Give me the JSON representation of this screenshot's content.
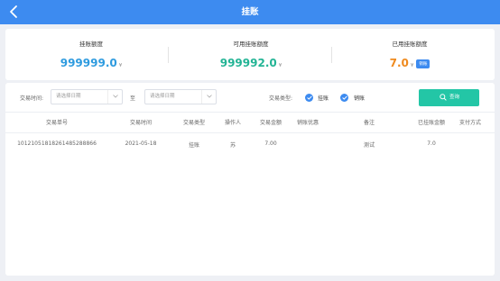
{
  "header": {
    "title": "挂账",
    "back_icon": "chevron-left-icon",
    "color": "#3d8bf0"
  },
  "summary": {
    "credit_limit": {
      "label": "挂账额度",
      "value": "999999.0",
      "unit": "¥",
      "color": "#2e9bdf"
    },
    "available_limit": {
      "label": "可用挂账额度",
      "value": "999992.0",
      "unit": "¥",
      "color": "#23b495"
    },
    "used_limit": {
      "label": "已用挂账额度",
      "value": "7.0",
      "unit": "¥",
      "color": "#ef8a1e",
      "action_label": "销账"
    }
  },
  "filters": {
    "time_label": "交易时间:",
    "start_placeholder": "请选择日期",
    "to_label": "至",
    "end_placeholder": "请选择日期",
    "type_label": "交易类型:",
    "type_options": [
      {
        "label": "挂账",
        "checked": true
      },
      {
        "label": "销账",
        "checked": true
      }
    ],
    "query_label": "查询",
    "query_color": "#23c6a6"
  },
  "table": {
    "columns": [
      "交易单号",
      "交易时间",
      "交易类型",
      "操作人",
      "交易金额",
      "销账优惠",
      "备注",
      "已挂账金额",
      "支付方式"
    ],
    "rows": [
      [
        "10121051818261485288866",
        "2021-05-18",
        "挂账",
        "苏",
        "7.00",
        "",
        "测试",
        "7.0",
        ""
      ]
    ]
  }
}
